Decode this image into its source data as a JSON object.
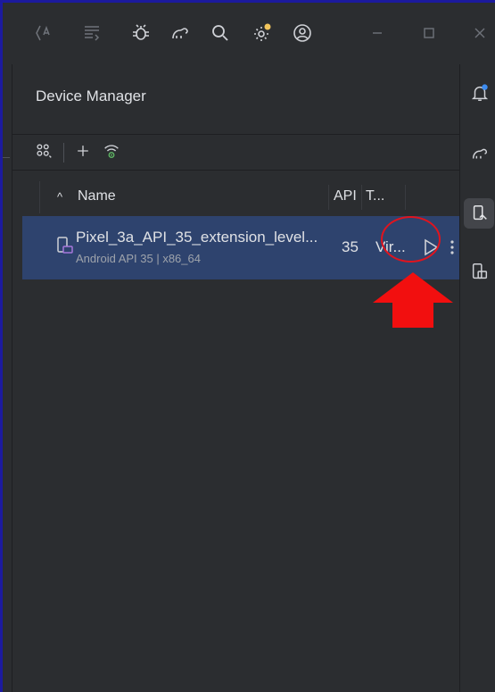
{
  "titlebar": {
    "icons": [
      "translate-icon",
      "format-icon",
      "bug-icon",
      "gradle-icon",
      "search-icon",
      "settings-update-icon",
      "account-icon",
      "minimize-icon",
      "maximize-icon",
      "close-icon"
    ]
  },
  "panel": {
    "title": "Device Manager"
  },
  "toolbar": {
    "icons": [
      "group-icon",
      "add-icon",
      "wifi-pair-icon"
    ]
  },
  "table": {
    "columns": {
      "name": "Name",
      "api": "API",
      "type": "T..."
    },
    "rows": [
      {
        "name": "Pixel_3a_API_35_extension_level...",
        "subtitle": "Android API 35 | x86_64",
        "api": "35",
        "type": "Vir..."
      }
    ]
  },
  "right_toolbar": {
    "icons": [
      "notifications-icon",
      "gradle-icon",
      "device-manager-icon",
      "running-devices-icon"
    ]
  },
  "colors": {
    "selection": "#2e436e",
    "annotation": "#e0141e",
    "background": "#2b2d30",
    "border": "#1c1a9e"
  }
}
